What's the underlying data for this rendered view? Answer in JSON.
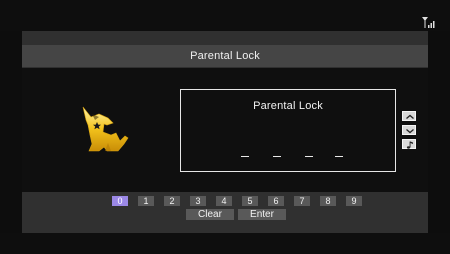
{
  "header": {
    "title": "Parental Lock"
  },
  "lock_box": {
    "title": "Parental Lock",
    "pin_slots": 4
  },
  "keypad": {
    "digits": [
      "0",
      "1",
      "2",
      "3",
      "4",
      "5",
      "6",
      "7",
      "8",
      "9"
    ],
    "selected_digit": "0",
    "clear_label": "Clear",
    "enter_label": "Enter"
  },
  "side_controls": [
    "chevron-up",
    "chevron-down",
    "music-note"
  ],
  "status": {
    "signal_icon": "antenna-signal"
  },
  "colors": {
    "selected_key": "#9b88e6",
    "dog_yellow": "#f2c21b",
    "key_bg": "#595959"
  }
}
